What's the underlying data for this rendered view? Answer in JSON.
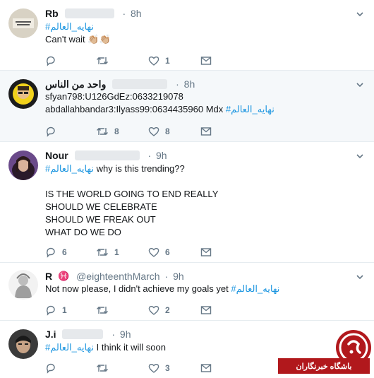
{
  "tweets": [
    {
      "name": "Rb",
      "time": "8h",
      "body_tag": "#نهایه_العالم",
      "body_text": "Can't wait 👏🏼👏🏼",
      "reply_count": "",
      "retweet_count": "",
      "like_count": "1"
    },
    {
      "name": "واحد من الناس",
      "time": "8h",
      "body_line1": "sfyan798:U126GdEz:0633219078",
      "body_line2_text": "abdallahbandar3:Ilyass99:0634435960 Mdx ",
      "body_tag": "#نهایه_العالم",
      "reply_count": "",
      "retweet_count": "8",
      "like_count": "8"
    },
    {
      "name": "Nour",
      "time": "9h",
      "body_tag": "#نهایه_العالم",
      "body_text": " why is this trending??",
      "body_lines": [
        "IS THE WORLD GOING TO END REALLY",
        "SHOULD WE CELEBRATE",
        "SHOULD WE FREAK OUT",
        "WHAT DO WE DO"
      ],
      "reply_count": "6",
      "retweet_count": "1",
      "like_count": "6"
    },
    {
      "name": "R",
      "zodiac": "♓",
      "handle": "@eighteenthMarch",
      "time": "9h",
      "body_text": "Not now please, I didn't achieve my goals yet ",
      "body_tag": "#نهایه_العالم",
      "reply_count": "1",
      "retweet_count": "",
      "like_count": "2"
    },
    {
      "name": "J.i",
      "time": "9h",
      "body_tag": "#نهایه_العالم",
      "body_text": " I think it will soon",
      "reply_count": "",
      "retweet_count": "",
      "like_count": "3"
    }
  ],
  "watermark": {
    "text": "باشگاه خبرنگاران",
    "color": "#b1181c"
  },
  "colors": {
    "link": "#1b95e0",
    "muted": "#657786",
    "highlight_bg": "#f5f8fa"
  }
}
